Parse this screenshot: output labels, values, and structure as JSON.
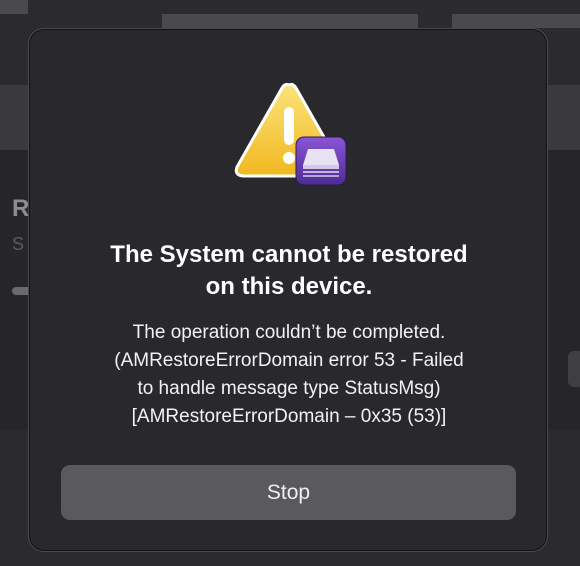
{
  "dialog": {
    "title_line1": "The System cannot be restored",
    "title_line2": "on this device.",
    "message_lines": [
      "The operation couldn’t be completed.",
      "(AMRestoreErrorDomain error 53 - Failed",
      "to handle message type StatusMsg)",
      "[AMRestoreErrorDomain – 0x35 (53)]"
    ],
    "stop_label": "Stop",
    "icon": "warning-triangle-with-configurator-badge-icon"
  },
  "background": {
    "partial_heading_letter": "R",
    "partial_subtitle_letter": "S"
  },
  "colors": {
    "warning_yellow": "#f4c531",
    "badge_purple": "#6f3fb8",
    "button_gray": "#5a595e",
    "dialog_bg": "#29282c"
  }
}
